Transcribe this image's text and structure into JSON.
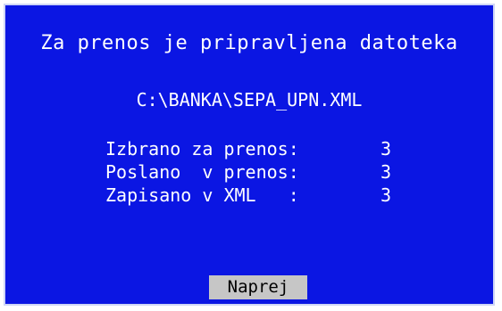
{
  "dialog": {
    "title": "Za prenos je pripravljena datoteka",
    "file_path": "C:\\BANKA\\SEPA_UPN.XML",
    "stats": [
      {
        "label": "Izbrano za prenos:",
        "value": "3"
      },
      {
        "label": "Poslano  v prenos:",
        "value": "3"
      },
      {
        "label": "Zapisano v XML   :",
        "value": "3"
      }
    ],
    "next_button_label": "Naprej"
  },
  "colors": {
    "background": "#0b16e3",
    "text": "#ffffff",
    "button_bg": "#c6c6c6",
    "border": "#cfd6f6"
  }
}
